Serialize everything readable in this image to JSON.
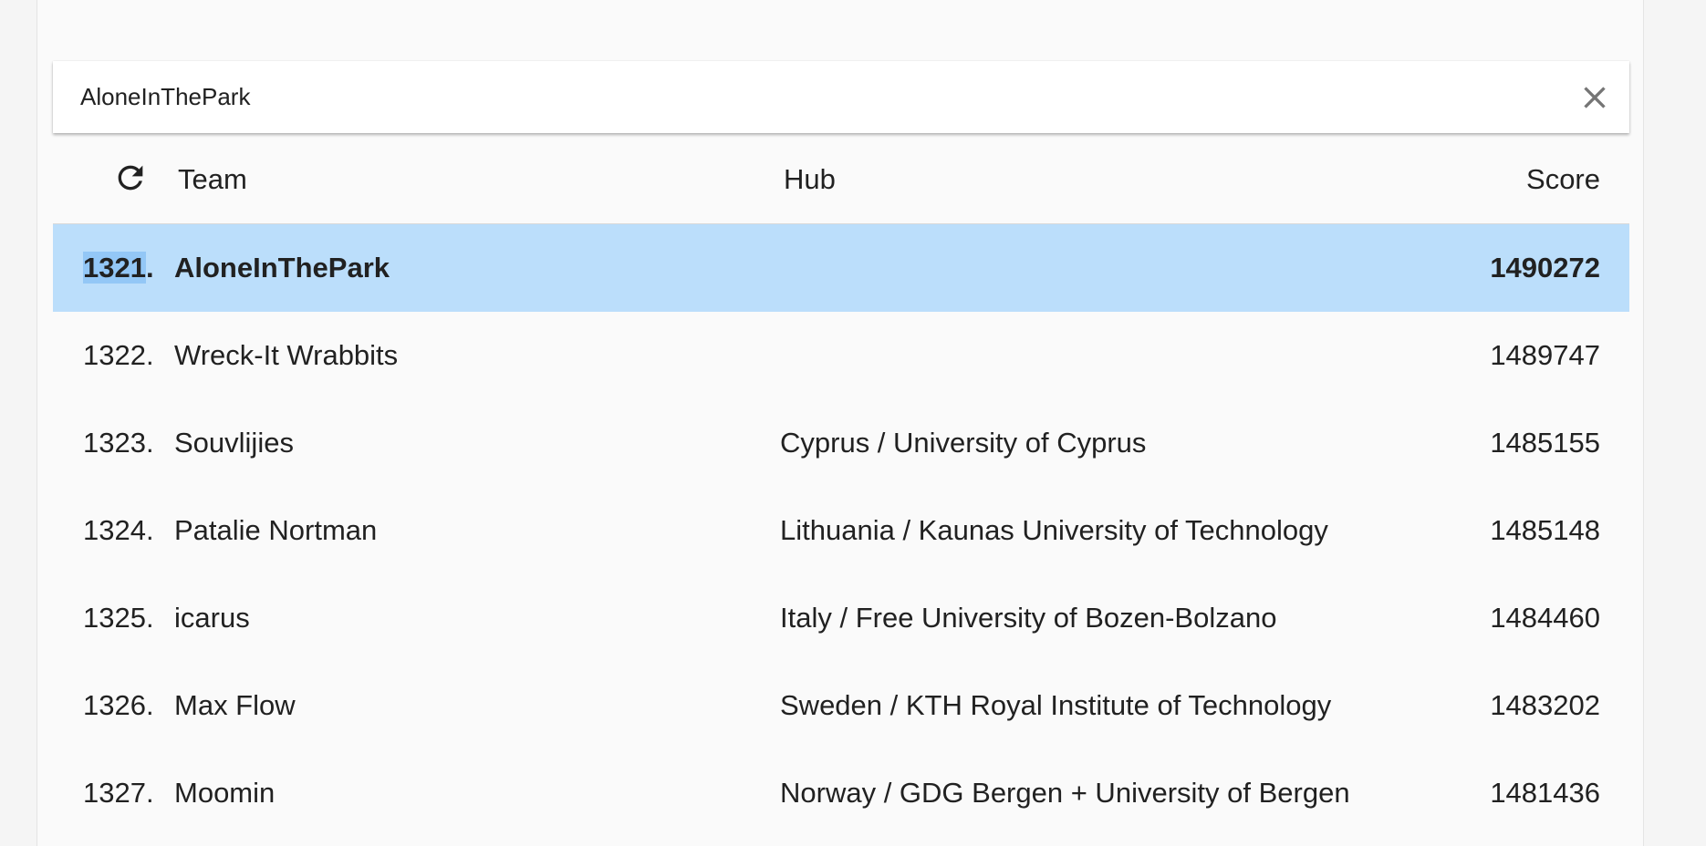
{
  "search": {
    "value": "AloneInThePark"
  },
  "table": {
    "headers": {
      "team": "Team",
      "hub": "Hub",
      "score": "Score"
    },
    "rows": [
      {
        "rank_num": "1321",
        "rank_suffix": ".",
        "team": "AloneInThePark",
        "hub": "",
        "score": "1490272",
        "selected": true
      },
      {
        "rank": "1322.",
        "team": "Wreck-It Wrabbits",
        "hub": "",
        "score": "1489747"
      },
      {
        "rank": "1323.",
        "team": "Souvlijies",
        "hub": "Cyprus / University of Cyprus",
        "score": "1485155"
      },
      {
        "rank": "1324.",
        "team": "Patalie Nortman",
        "hub": "Lithuania / Kaunas University of Technology",
        "score": "1485148"
      },
      {
        "rank": "1325.",
        "team": "icarus",
        "hub": "Italy / Free University of Bozen-Bolzano",
        "score": "1484460"
      },
      {
        "rank": "1326.",
        "team": "Max Flow",
        "hub": "Sweden / KTH Royal Institute of Technology",
        "score": "1483202"
      },
      {
        "rank": "1327.",
        "team": "Moomin",
        "hub": "Norway / GDG Bergen + University of Bergen",
        "score": "1481436"
      }
    ]
  },
  "icons": {
    "clear": "close-icon",
    "refresh": "refresh-icon"
  },
  "colors": {
    "selected_row": "#bbdefb",
    "text_selection": "#90caf9",
    "background": "#fafafa"
  }
}
